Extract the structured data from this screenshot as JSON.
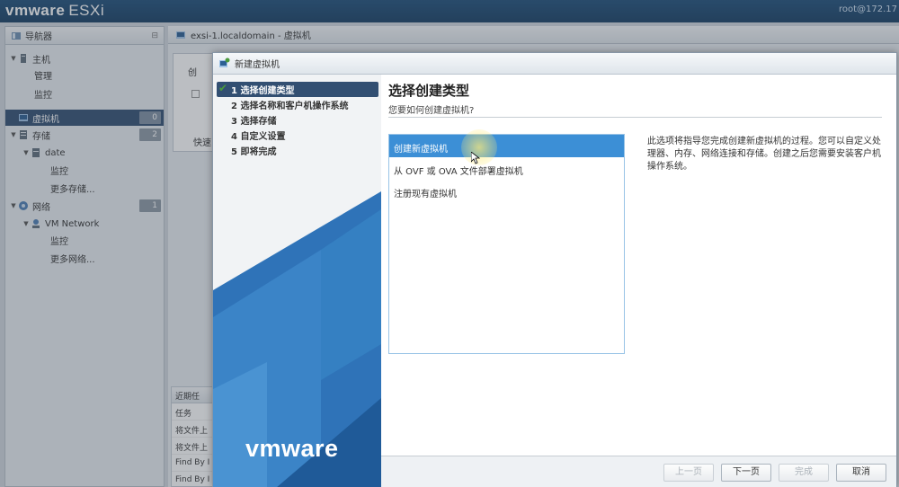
{
  "topbar": {
    "brand": "vmware",
    "product": "ESXi",
    "user": "root@172.17"
  },
  "navigator": {
    "title": "导航器",
    "items": [
      {
        "label": "主机",
        "indent": 0,
        "expanded": true
      },
      {
        "label": "管理",
        "indent": 1
      },
      {
        "label": "监控",
        "indent": 1
      },
      {
        "label": "虚拟机",
        "indent": 0,
        "count": "0",
        "selected": true
      },
      {
        "label": "存储",
        "indent": 0,
        "count": "2",
        "expanded": true
      },
      {
        "label": "date",
        "indent": 1,
        "expanded": true
      },
      {
        "label": "监控",
        "indent": 2
      },
      {
        "label": "更多存储...",
        "indent": 2
      },
      {
        "label": "网络",
        "indent": 0,
        "count": "1",
        "expanded": true
      },
      {
        "label": "VM Network",
        "indent": 1,
        "expanded": true
      },
      {
        "label": "监控",
        "indent": 2
      },
      {
        "label": "更多网络...",
        "indent": 2
      }
    ]
  },
  "content": {
    "breadcrumb": "exsi-1.localdomain - 虚拟机",
    "bg_button": "创",
    "bg_quick": "快速",
    "recent": {
      "title": "近期任",
      "column": "任务",
      "rows": [
        "将文件上",
        "将文件上",
        "Find By I",
        "Find By I"
      ]
    }
  },
  "dialog": {
    "title": "新建虚拟机",
    "steps": [
      {
        "label": "1 选择创建类型",
        "active": true,
        "done": true
      },
      {
        "label": "2 选择名称和客户机操作系统"
      },
      {
        "label": "3 选择存储"
      },
      {
        "label": "4 自定义设置"
      },
      {
        "label": "5 即将完成"
      }
    ],
    "logo": "vmware",
    "heading": "选择创建类型",
    "subheading": "您要如何创建虚拟机?",
    "options": [
      {
        "label": "创建新虚拟机",
        "selected": true
      },
      {
        "label": "从 OVF 或 OVA 文件部署虚拟机"
      },
      {
        "label": "注册现有虚拟机"
      }
    ],
    "description": "此选项将指导您完成创建新虚拟机的过程。您可以自定义处理器、内存、网络连接和存储。创建之后您需要安装客户机操作系统。",
    "buttons": {
      "back": "上一页",
      "next": "下一页",
      "finish": "完成",
      "cancel": "取消"
    }
  },
  "colors": {
    "topbar": "#1f4f7a",
    "selected": "#324f72",
    "accent": "#3c8fd6",
    "check": "#4a9a3c"
  }
}
